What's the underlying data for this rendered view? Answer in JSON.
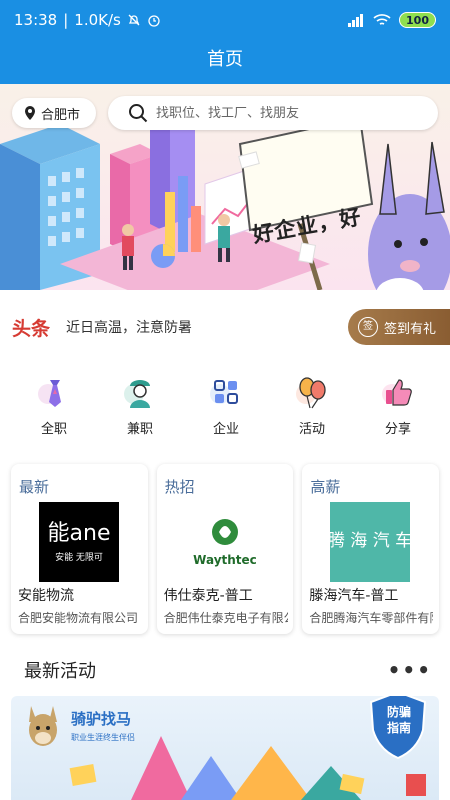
{
  "status_bar": {
    "time": "13:38",
    "net_speed": "1.0K/s",
    "battery": "100"
  },
  "nav": {
    "title": "首页"
  },
  "location": {
    "city": "合肥市"
  },
  "search": {
    "placeholder": "找职位、找工厂、找朋友"
  },
  "banner": {
    "sign_text": "好企业，好"
  },
  "headline": {
    "tag": "头条",
    "text": "近日高温，注意防暑",
    "checkin_seal": "签",
    "checkin_label": "签到有礼"
  },
  "categories": [
    {
      "label": "全职",
      "icon": "tie-icon"
    },
    {
      "label": "兼职",
      "icon": "worker-icon"
    },
    {
      "label": "企业",
      "icon": "grid-icon"
    },
    {
      "label": "活动",
      "icon": "balloon-icon"
    },
    {
      "label": "分享",
      "icon": "thumbs-up-icon"
    }
  ],
  "job_cards": [
    {
      "category": "最新",
      "name": "安能物流",
      "company": "合肥安能物流有限公司",
      "logo_text": "能ane",
      "logo_sub": "安能  无限可"
    },
    {
      "category": "热招",
      "name": "伟仕泰克-普工",
      "company": "合肥伟仕泰克电子有限公司",
      "logo_text": "Waythtec"
    },
    {
      "category": "高薪",
      "name": "滕海汽车-普工",
      "company": "合肥腾海汽车零部件有限公司",
      "logo_text": "腾 海 汽 车"
    }
  ],
  "activities": {
    "title": "最新活动",
    "more": "•••",
    "banner_brand": "骑驴找马",
    "banner_slogan": "职业生涯终生伴侣",
    "shield_text": "防骗 指南"
  },
  "colors": {
    "primary": "#1a8fe3",
    "headline_red": "#d63b33",
    "checkin_brown": "#9a6c3e",
    "card_category": "#4a6d9a"
  }
}
